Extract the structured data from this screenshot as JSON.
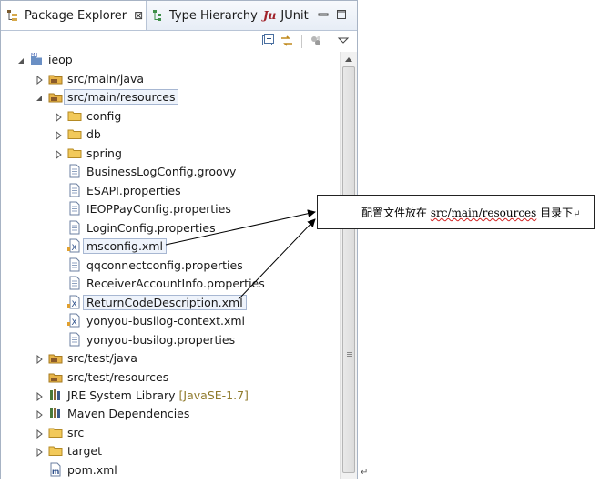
{
  "tabs": [
    {
      "label": "Package Explorer",
      "icon": "package-explorer-icon",
      "active": true,
      "close": "⊠"
    },
    {
      "label": "Type Hierarchy",
      "icon": "type-hierarchy-icon"
    },
    {
      "label": "JUnit",
      "icon": "junit-icon",
      "icon_text": "Ju"
    }
  ],
  "toolbar": [
    "collapse-all-icon",
    "link-with-editor-icon",
    "focus-on-active-task-icon",
    "view-menu-icon"
  ],
  "tree": {
    "project": "ieop",
    "src_main_java": "src/main/java",
    "src_main_resources": "src/main/resources",
    "folders": [
      "config",
      "db",
      "spring"
    ],
    "files": [
      "BusinessLogConfig.groovy",
      "ESAPI.properties",
      "IEOPPayConfig.properties",
      "LoginConfig.properties",
      "msconfig.xml",
      "qqconnectconfig.properties",
      "ReceiverAccountInfo.properties",
      "ReturnCodeDescription.xml",
      "yonyou-busilog-context.xml",
      "yonyou-busilog.properties"
    ],
    "src_test_java": "src/test/java",
    "src_test_resources": "src/test/resources",
    "jre": "JRE System Library",
    "jre_version": "[JavaSE-1.7]",
    "maven": "Maven Dependencies",
    "src": "src",
    "target": "target",
    "pom": "pom.xml"
  },
  "callout": {
    "prefix": "配置文件放在 ",
    "path": "src/main/resources",
    "suffix": " 目录下",
    "mark": "↵"
  },
  "end_mark": "↵",
  "colors": {
    "accent": "#3a6ea5",
    "library_version": "#8f7a2b",
    "selection": "#eef3fb"
  }
}
